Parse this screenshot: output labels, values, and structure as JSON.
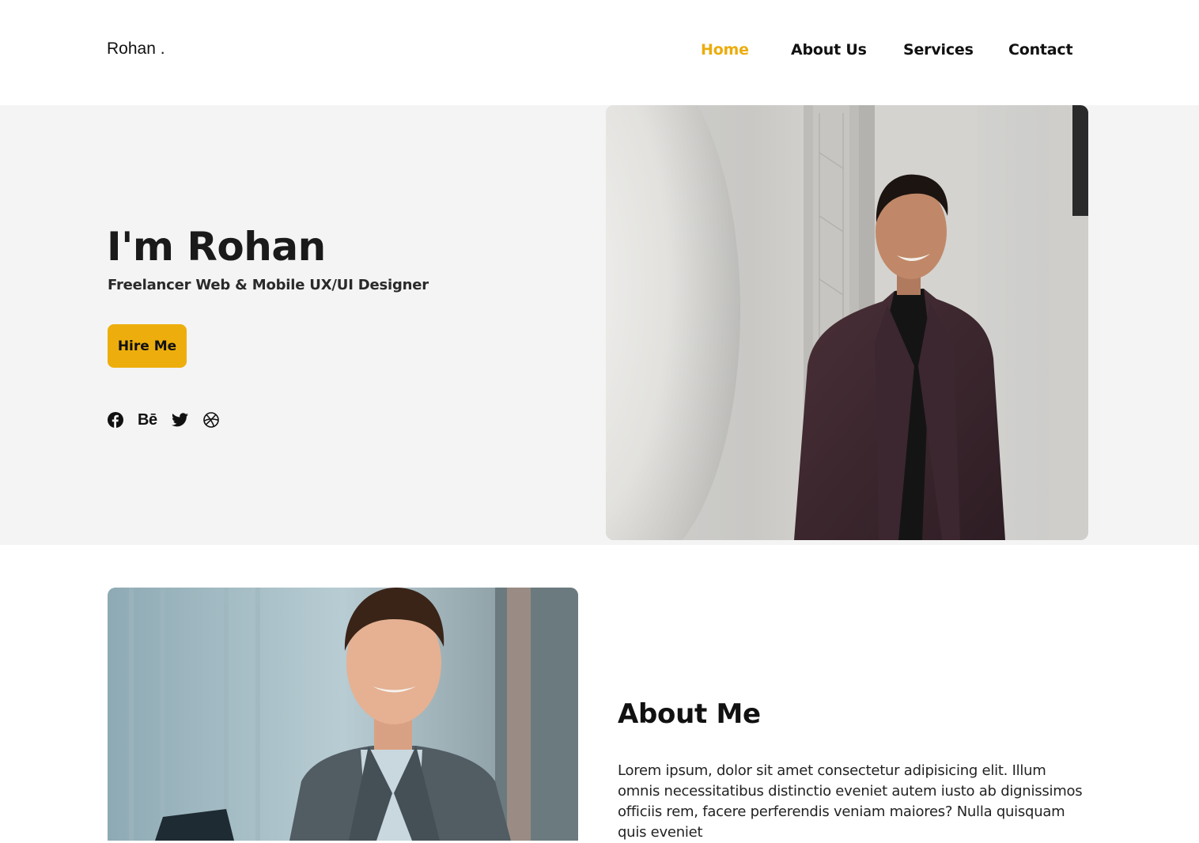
{
  "nav": {
    "logo": "Rohan .",
    "items": [
      {
        "label": "Home",
        "active": true
      },
      {
        "label": "About Us",
        "active": false
      },
      {
        "label": "Services",
        "active": false
      },
      {
        "label": "Contact",
        "active": false
      }
    ]
  },
  "hero": {
    "title": "I'm Rohan",
    "subtitle": "Freelancer Web & Mobile UX/UI Designer",
    "cta_label": "Hire Me",
    "socials": [
      {
        "icon": "facebook-icon"
      },
      {
        "icon": "behance-icon",
        "text": "Bē"
      },
      {
        "icon": "twitter-icon"
      },
      {
        "icon": "dribbble-icon"
      }
    ]
  },
  "about": {
    "title": "About Me",
    "text": "Lorem ipsum, dolor sit amet consectetur adipisicing elit. Illum omnis necessitatibus distinctio eveniet autem iusto ab dignissimos officiis rem, facere perferendis veniam maiores? Nulla quisquam quis eveniet"
  },
  "colors": {
    "accent": "#edae0d",
    "hero_bg": "#f4f4f4",
    "text": "#111111"
  }
}
